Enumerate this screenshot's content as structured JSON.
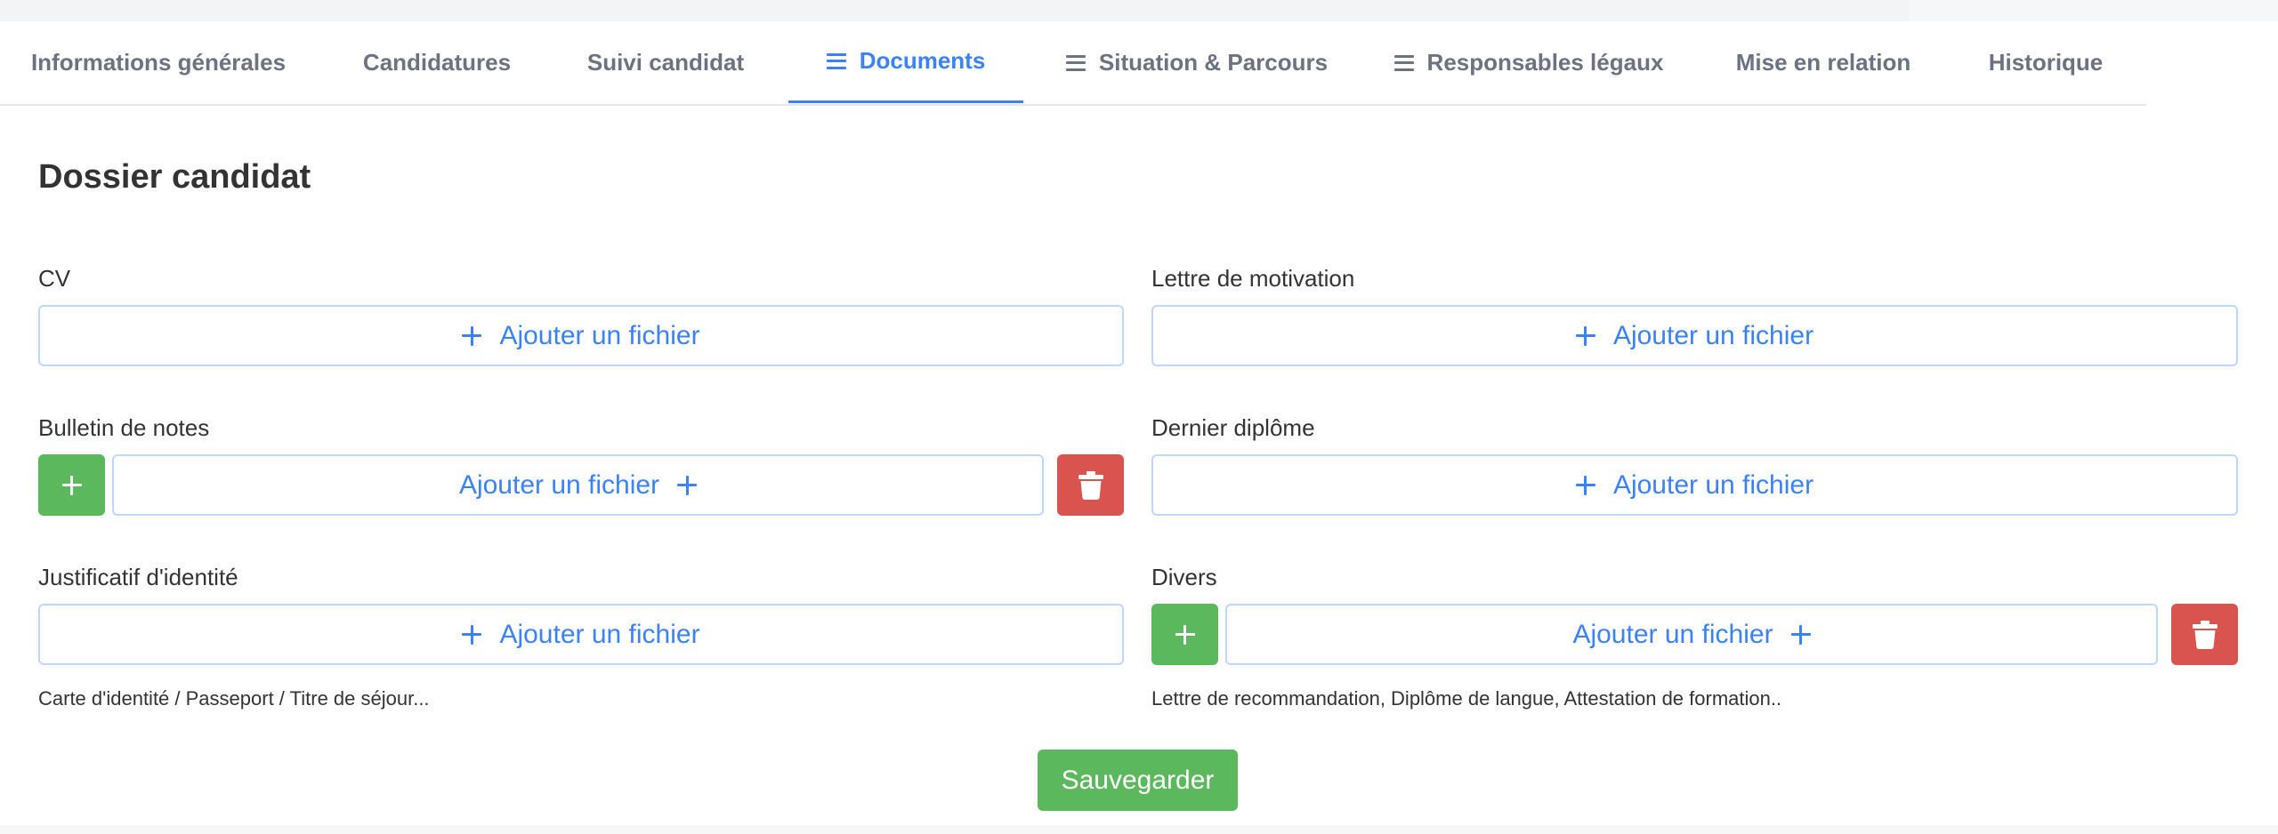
{
  "tabs": [
    {
      "label": "Informations générales",
      "has_icon": false
    },
    {
      "label": "Candidatures",
      "has_icon": false
    },
    {
      "label": "Suivi candidat",
      "has_icon": false
    },
    {
      "label": "Documents",
      "has_icon": true,
      "active": true
    },
    {
      "label": "Situation & Parcours",
      "has_icon": true
    },
    {
      "label": "Responsables légaux",
      "has_icon": true
    },
    {
      "label": "Mise en relation",
      "has_icon": false
    },
    {
      "label": "Historique",
      "has_icon": false
    }
  ],
  "tab_icon": "menu-icon",
  "page_title": "Dossier candidat",
  "add_file_label": "Ajouter un fichier",
  "fields": {
    "cv": {
      "label": "CV"
    },
    "lettre_motivation": {
      "label": "Lettre de motivation"
    },
    "bulletin": {
      "label": "Bulletin de notes"
    },
    "diplome": {
      "label": "Dernier diplôme"
    },
    "identite": {
      "label": "Justificatif d'identité",
      "hint": "Carte d'identité / Passeport / Titre de séjour..."
    },
    "divers": {
      "label": "Divers",
      "hint": "Lettre de recommandation, Diplôme de langue, Attestation de formation.."
    }
  },
  "icons": {
    "add": "plus-icon",
    "delete": "trash-icon"
  },
  "save_label": "Sauvegarder",
  "colors": {
    "accent": "#3b82f6",
    "success": "#5cb85c",
    "danger": "#d9534f",
    "tab_inactive": "#6b7280",
    "border": "#bfd7f8"
  }
}
